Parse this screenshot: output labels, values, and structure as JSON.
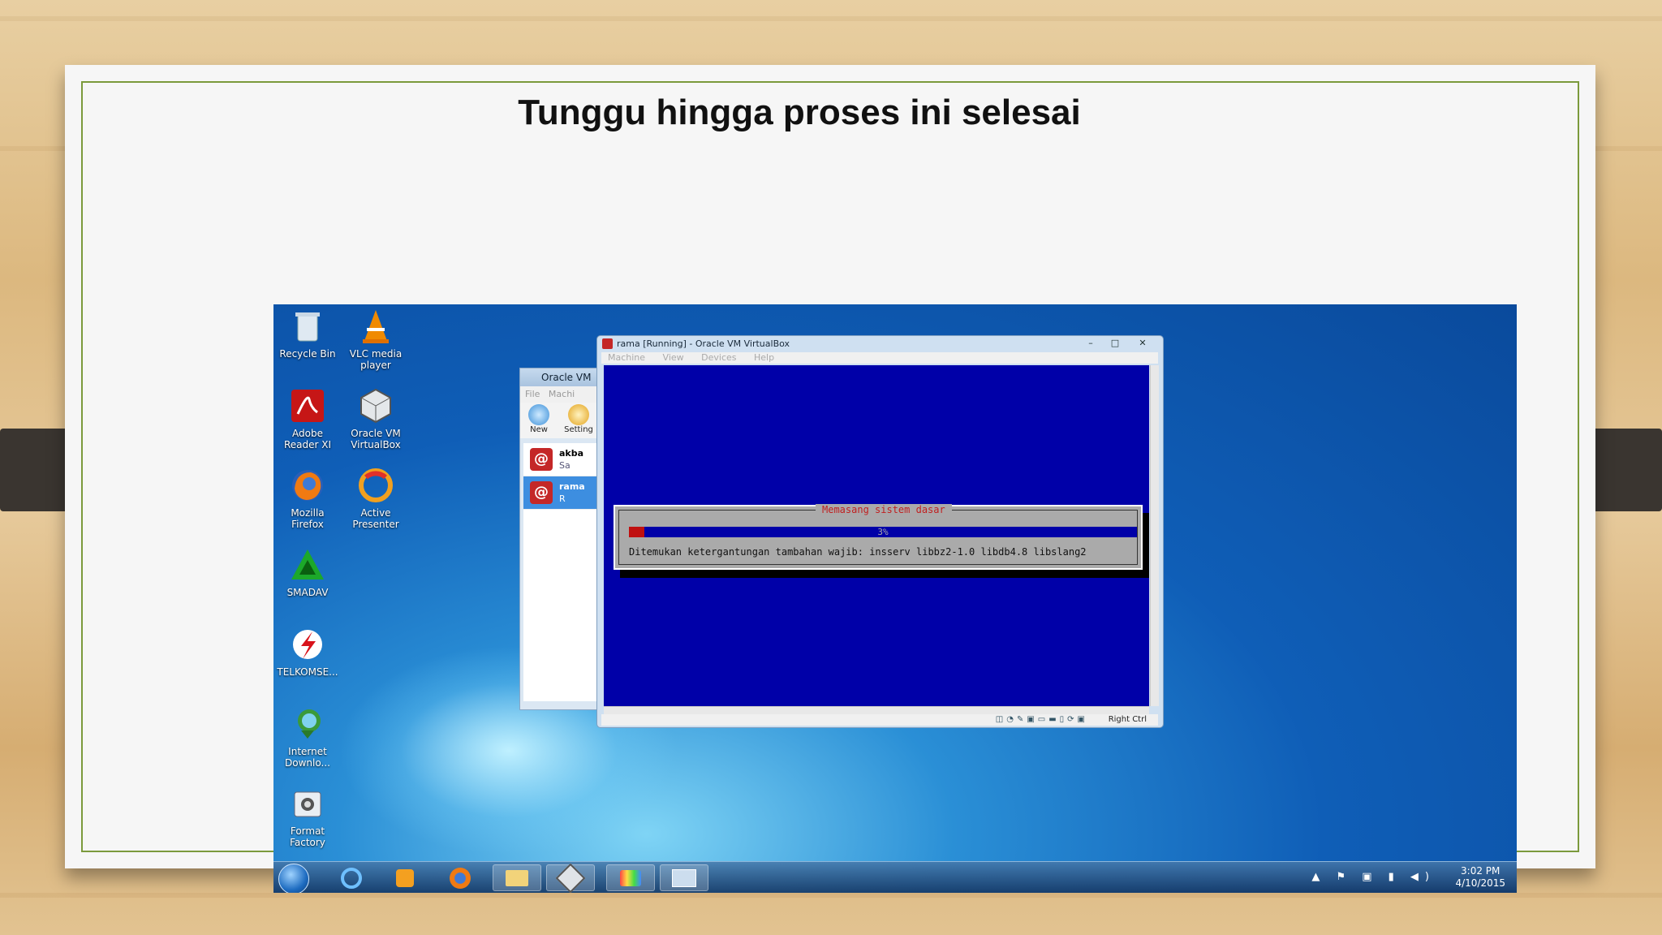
{
  "slide": {
    "title": "Tunggu hingga proses ini selesai"
  },
  "desktop": {
    "icons": [
      {
        "label": "Recycle Bin",
        "icon": "recycle-bin-icon"
      },
      {
        "label": "VLC media player",
        "icon": "vlc-icon"
      },
      {
        "label": "Adobe Reader XI",
        "icon": "adobe-reader-icon"
      },
      {
        "label": "Oracle VM VirtualBox",
        "icon": "virtualbox-icon"
      },
      {
        "label": "Mozilla Firefox",
        "icon": "firefox-icon"
      },
      {
        "label": "Active Presenter",
        "icon": "active-presenter-icon"
      },
      {
        "label": "SMADAV",
        "icon": "smadav-icon"
      },
      {
        "label": "TELKOMSE...",
        "icon": "telkomsel-icon"
      },
      {
        "label": "Internet Downlo...",
        "icon": "idm-icon"
      },
      {
        "label": "Format Factory",
        "icon": "format-factory-icon"
      }
    ]
  },
  "vbox_manager": {
    "title": "Oracle VM",
    "menu": [
      "File",
      "Machi"
    ],
    "toolbar": [
      "New",
      "Setting"
    ],
    "vms": [
      {
        "name": "akba",
        "state": "Sa"
      },
      {
        "name": "rama",
        "state": "R"
      }
    ]
  },
  "vm_window": {
    "title": "rama [Running] - Oracle VM VirtualBox",
    "menu": [
      "Machine",
      "View",
      "Devices",
      "Help"
    ],
    "controls": {
      "minimize": "–",
      "maximize": "□",
      "close": "✕"
    },
    "status_right": "Right Ctrl",
    "status_icons": "◫◔✎▣▭▬▯⟳▣"
  },
  "installer": {
    "dialog_title": "Memasang sistem dasar",
    "progress_percent": 3,
    "progress_label": "3%",
    "message": "Ditemukan ketergantungan tambahan wajib: insserv libbz2-1.0 libdb4.8 libslang2"
  },
  "taskbar": {
    "items": [
      "start-orb-icon",
      "ie-icon",
      "media-player-icon",
      "firefox-icon",
      "explorer-icon",
      "virtualbox-icon",
      "paint-icon",
      "vm-window-icon"
    ],
    "time": "3:02 PM",
    "date": "4/10/2015",
    "tray": "▲ ⚑ ▣ ▮ ◀)"
  }
}
